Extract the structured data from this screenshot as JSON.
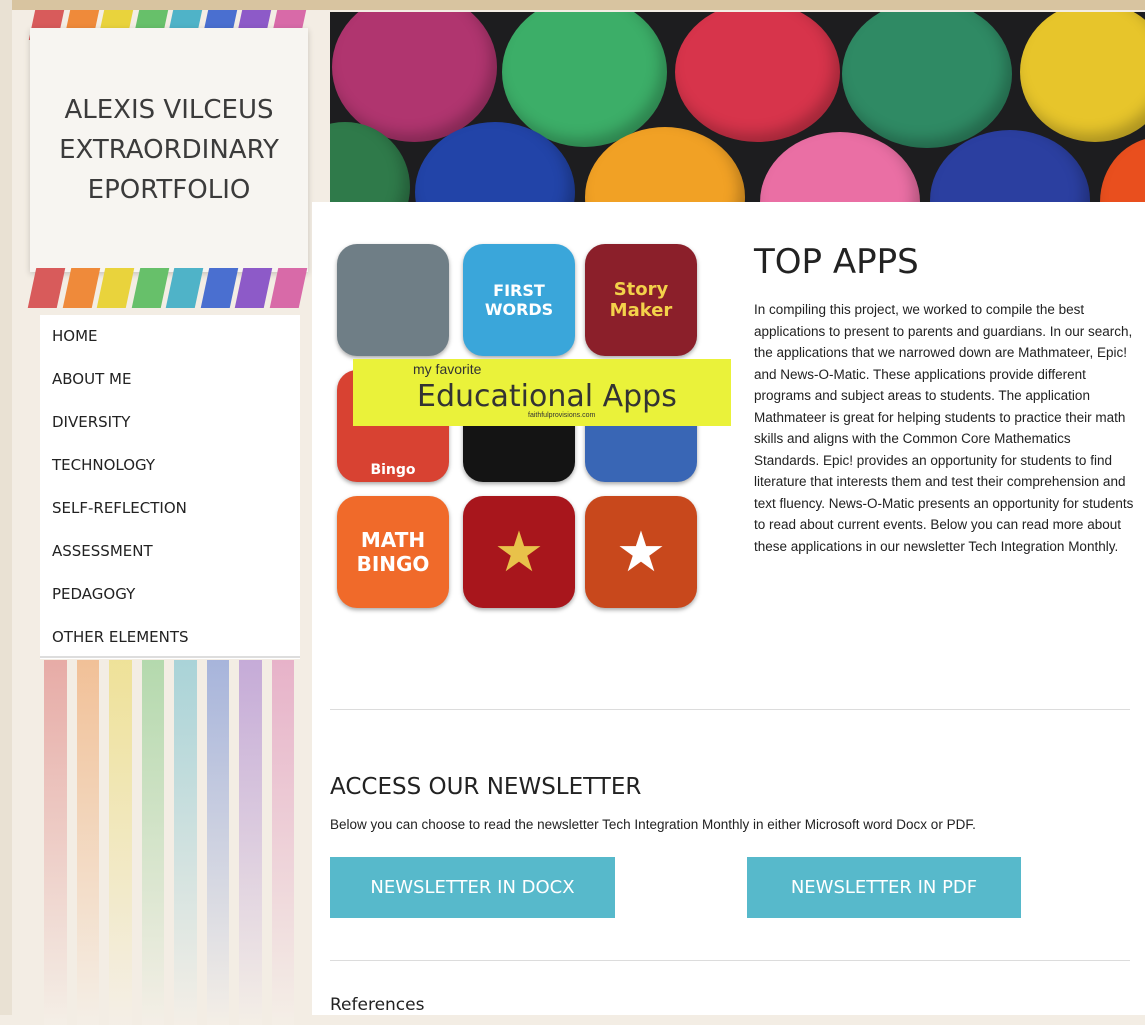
{
  "site": {
    "title": "ALEXIS VILCEUS EXTRAORDINARY EPORTFOLIO"
  },
  "nav": {
    "items": [
      {
        "label": "HOME"
      },
      {
        "label": "ABOUT ME"
      },
      {
        "label": "DIVERSITY"
      },
      {
        "label": "TECHNOLOGY"
      },
      {
        "label": "SELF-REFLECTION"
      },
      {
        "label": "ASSESSMENT"
      },
      {
        "label": "PEDAGOGY"
      },
      {
        "label": "OTHER ELEMENTS"
      }
    ]
  },
  "colors": {
    "stripes": [
      "#d85b5b",
      "#ef8a3a",
      "#e9d33c",
      "#67c06a",
      "#4fb3c8",
      "#4a6fd0",
      "#8d5ac8",
      "#d86aa8"
    ],
    "button": "#57b9cb",
    "apps_banner": "#eaf23a"
  },
  "apps_image": {
    "banner_small": "my favorite",
    "banner_big": "Educational Apps",
    "banner_tiny": "faithfulprovisions.com",
    "tiles": [
      {
        "label": "",
        "icon": "robot-icon",
        "color": "#6f7e86"
      },
      {
        "label": "FIRST WORDS",
        "icon": "first-words-icon",
        "color": "#3aa6da"
      },
      {
        "label": "Story Maker",
        "icon": "story-maker-icon",
        "color": "#8b1f2a"
      },
      {
        "label": "Bingo",
        "icon": "barn-icon",
        "color": "#d84232"
      },
      {
        "label": "",
        "icon": "constellation-icon",
        "color": "#141414"
      },
      {
        "label": "",
        "icon": "hero-icon",
        "color": "#3966b5"
      },
      {
        "label": "MATH BINGO",
        "icon": "math-bingo-icon",
        "color": "#f06a2a"
      },
      {
        "label": "★",
        "icon": "star-icon",
        "color": "#a8161c"
      },
      {
        "label": "★",
        "icon": "star-circle-icon",
        "color": "#c8481c"
      }
    ]
  },
  "top_apps": {
    "title": "TOP APPS",
    "body": "In compiling this project, we worked to compile the best applications to present to parents and guardians. In our search, the applications that we narrowed down are Mathmateer, Epic! and News-O-Matic. These applications provide different programs and subject areas to students. The application Mathmateer is great for helping students to practice their math skills and aligns with the Common Core Mathematics Standards. Epic! provides an opportunity for students to find literature that interests them and test their comprehension and text fluency. News-O-Matic presents an opportunity for students to read about current events. Below you can read more about these applications in our newsletter Tech Integration Monthly."
  },
  "newsletter": {
    "title": "ACCESS OUR NEWSLETTER",
    "description": "Below you can choose to read the newsletter Tech Integration Monthly in either Microsoft word Docx or PDF.",
    "docx_label": "NEWSLETTER IN DOCX",
    "pdf_label": "NEWSLETTER  IN PDF"
  },
  "references": {
    "label": "References"
  }
}
